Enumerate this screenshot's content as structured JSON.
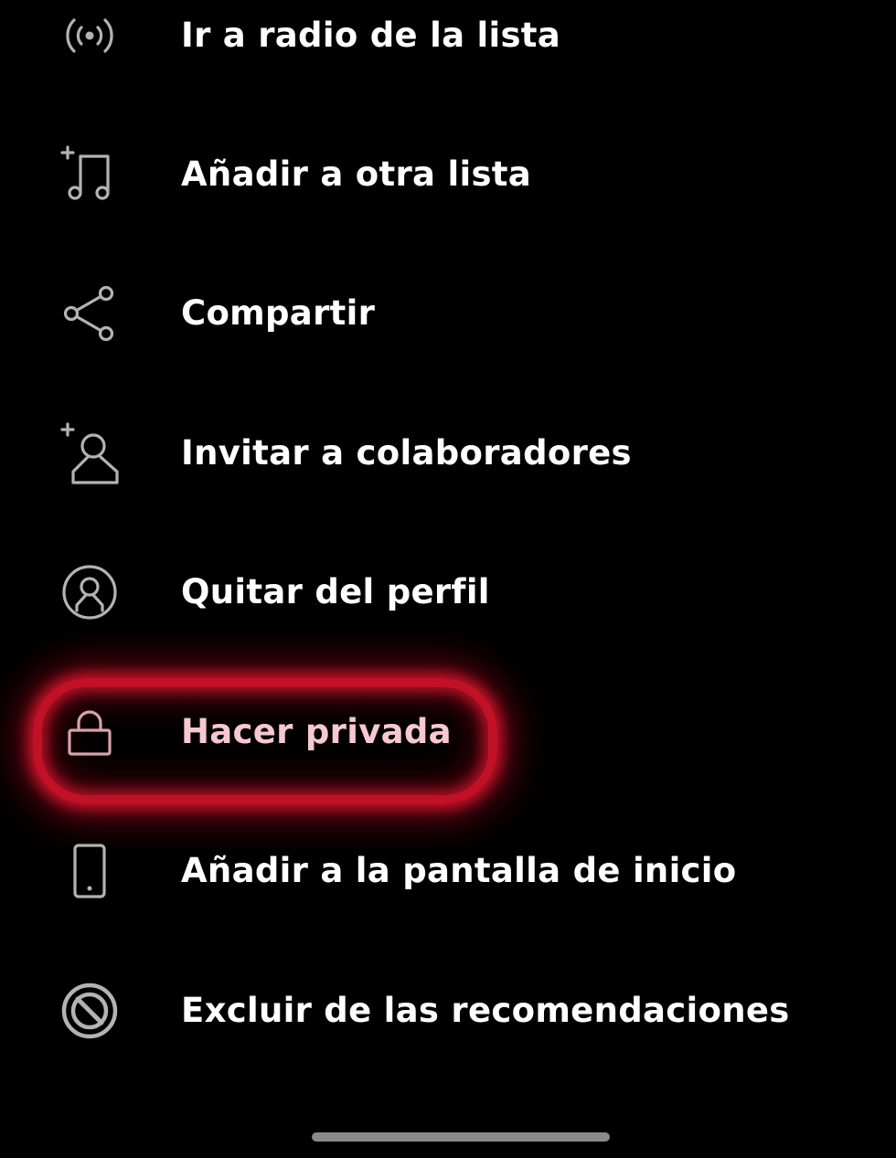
{
  "menu": {
    "items": [
      {
        "label": "Ir a radio de la lista",
        "icon": "radio-icon"
      },
      {
        "label": "Añadir a otra lista",
        "icon": "add-to-playlist-icon"
      },
      {
        "label": "Compartir",
        "icon": "share-icon"
      },
      {
        "label": "Invitar a colaboradores",
        "icon": "add-collaborator-icon"
      },
      {
        "label": "Quitar del perfil",
        "icon": "profile-icon"
      },
      {
        "label": "Hacer privada",
        "icon": "lock-icon"
      },
      {
        "label": "Añadir a la pantalla de inicio",
        "icon": "phone-icon"
      },
      {
        "label": "Excluir de las recomendaciones",
        "icon": "block-icon"
      }
    ],
    "highlighted_index": 5
  },
  "colors": {
    "background": "#000000",
    "text": "#ffffff",
    "icon": "#b3b3b3",
    "highlight": "#c01126",
    "home_indicator": "#8a8a8a"
  }
}
